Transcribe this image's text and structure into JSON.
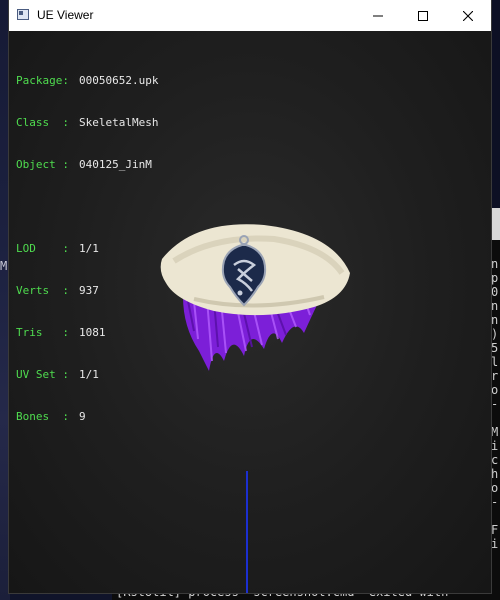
{
  "window": {
    "title": "UE Viewer",
    "controls": [
      "minimize",
      "maximize",
      "close"
    ]
  },
  "info": {
    "package": {
      "label": "Package:",
      "value": "00050652.upk"
    },
    "class": {
      "label": "Class  :",
      "value": "SkeletalMesh"
    },
    "object": {
      "label": "Object :",
      "value": "040125_JinM"
    },
    "lod": {
      "label": "LOD    :",
      "value": "1/1"
    },
    "verts": {
      "label": "Verts  :",
      "value": "937"
    },
    "tris": {
      "label": "Tris   :",
      "value": "1081"
    },
    "uvset": {
      "label": "UV Set :",
      "value": "1/1"
    },
    "bones": {
      "label": "Bones  :",
      "value": "9"
    }
  },
  "colors": {
    "label_green": "#4fdc4f",
    "value_white": "#e8e8e8",
    "hat_cream": "#efe9d6",
    "hair_purple": "#8a2be2",
    "emblem_navy": "#1c2a4a",
    "axis_blue": "#1c2fd0"
  },
  "background": {
    "desktop_letter": "M",
    "side_console_text": "n\np\n0\nn\nn\n)\n5\nl\nr\no\n-\n\nM\ni\nc\nh\no\n-\n\nF\ni",
    "bottom_console_text": "[RstUtil] process \"screenshot.cmd\" exited with"
  }
}
